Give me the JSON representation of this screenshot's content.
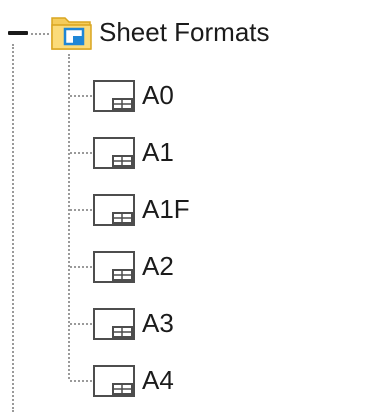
{
  "tree": {
    "root": {
      "label": "Sheet Formats",
      "icon": "folder-icon",
      "expanded": true
    },
    "children": [
      {
        "label": "A0",
        "icon": "sheet-format-icon"
      },
      {
        "label": "A1",
        "icon": "sheet-format-icon"
      },
      {
        "label": "A1F",
        "icon": "sheet-format-icon"
      },
      {
        "label": "A2",
        "icon": "sheet-format-icon"
      },
      {
        "label": "A3",
        "icon": "sheet-format-icon"
      },
      {
        "label": "A4",
        "icon": "sheet-format-icon"
      }
    ]
  },
  "colors": {
    "folder_yellow": "#f5cc5b",
    "folder_blue": "#1f86d6",
    "sheet_border": "#4d4d4d",
    "connector": "#9a9a9a"
  }
}
